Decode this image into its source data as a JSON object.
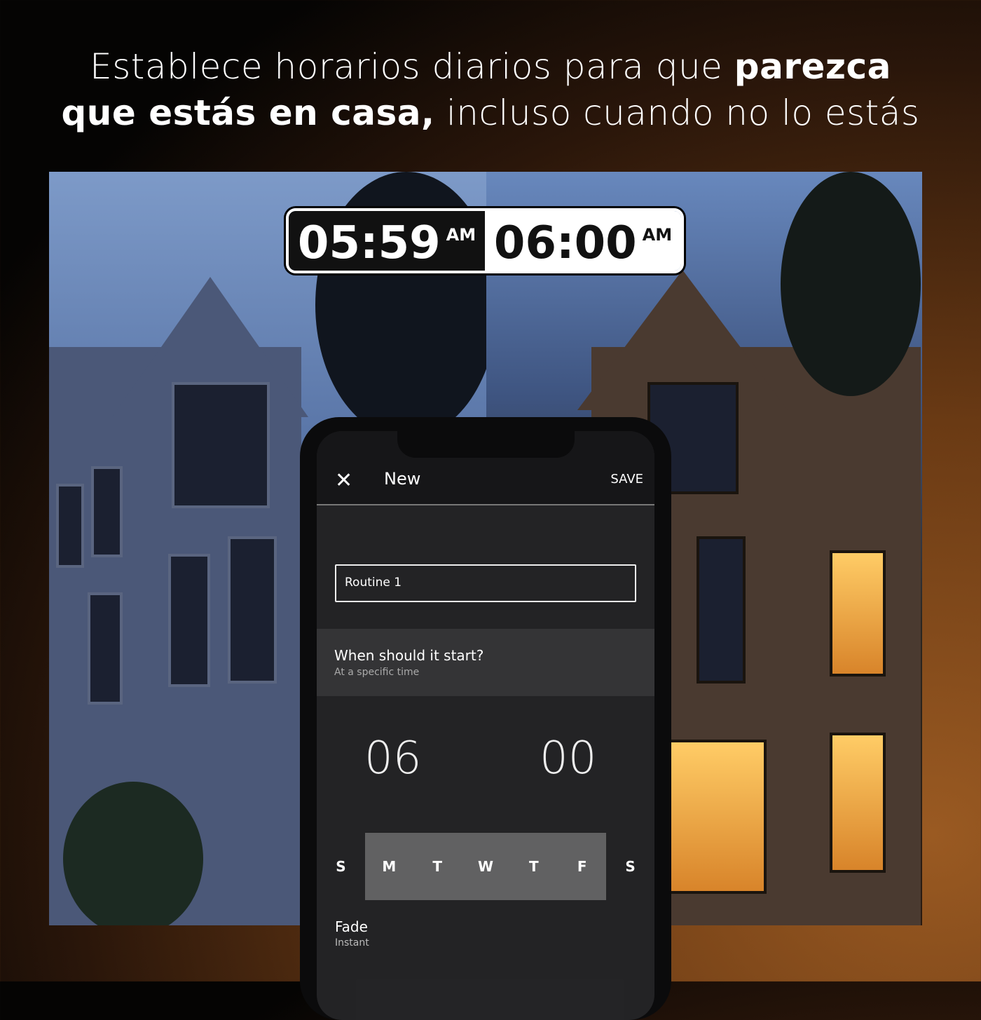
{
  "headline": {
    "line1_regular": "Establece horarios diarios para que ",
    "line1_bold": "parezca",
    "line2_bold": "que estás en casa,",
    "line2_regular": " incluso cuando no lo estás"
  },
  "clock": {
    "before": {
      "time": "05:59",
      "period": "AM"
    },
    "after": {
      "time": "06:00",
      "period": "AM"
    }
  },
  "app": {
    "header": {
      "close_icon": "close-icon",
      "title": "New",
      "save_label": "SAVE"
    },
    "name_field": {
      "value": "Routine 1"
    },
    "start": {
      "label": "When should it start?",
      "value": "At a specific time"
    },
    "time_picker": {
      "hour": "06",
      "minute": "00"
    },
    "days": [
      {
        "label": "S",
        "selected": false
      },
      {
        "label": "M",
        "selected": true
      },
      {
        "label": "T",
        "selected": true
      },
      {
        "label": "W",
        "selected": true
      },
      {
        "label": "T",
        "selected": true
      },
      {
        "label": "F",
        "selected": true
      },
      {
        "label": "S",
        "selected": false
      }
    ],
    "fade": {
      "label": "Fade",
      "value": "Instant"
    }
  },
  "colors": {
    "warm_light": "#ffcc66",
    "dusk_blue": "#5a76a8"
  }
}
